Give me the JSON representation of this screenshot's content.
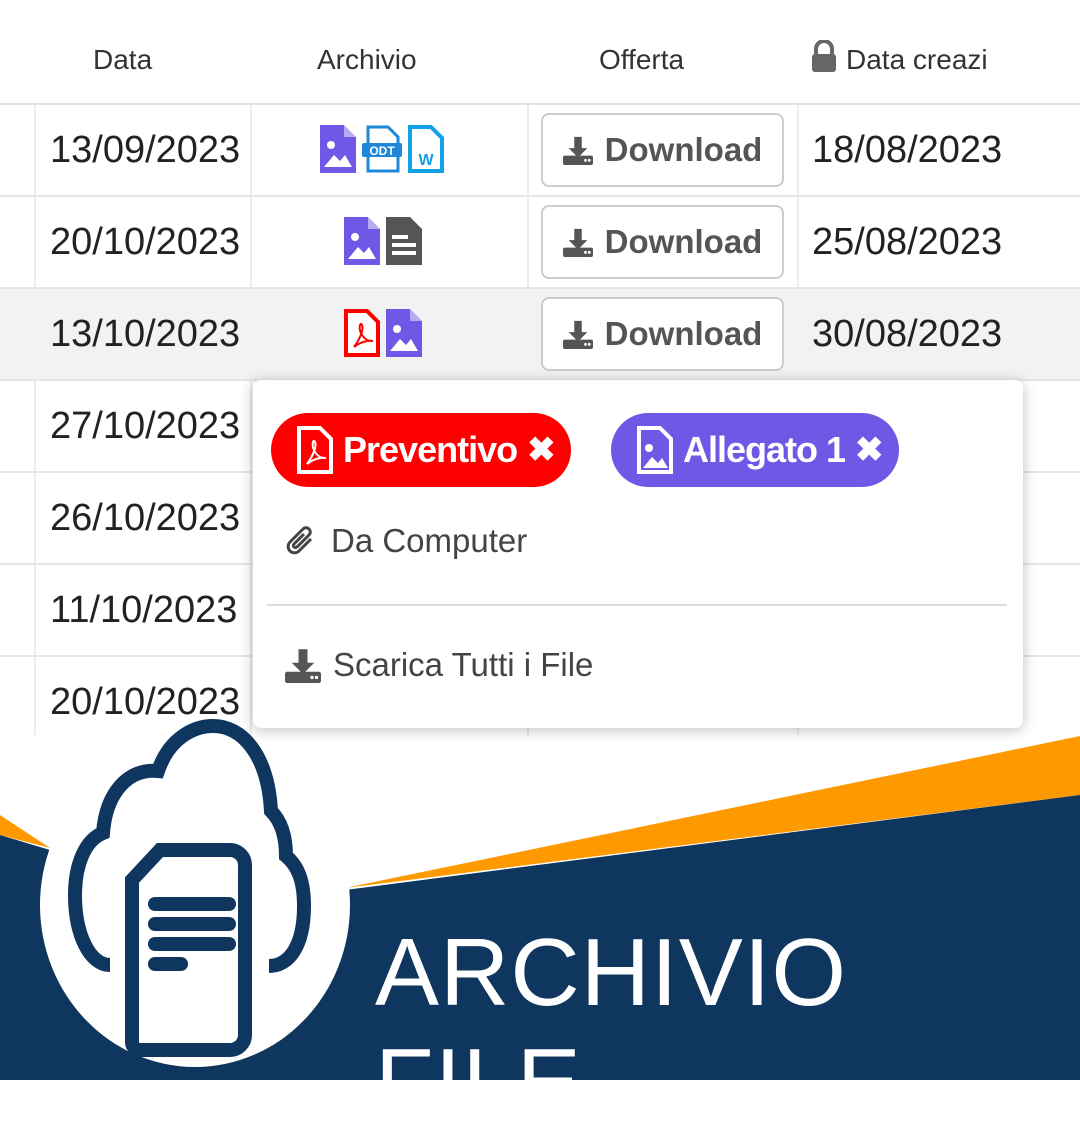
{
  "table": {
    "headers": {
      "data": "Data",
      "archivio": "Archivio",
      "offerta": "Offerta",
      "data_creazione": "Data creazi"
    },
    "download_label": "Download",
    "rows": [
      {
        "data": "13/09/2023",
        "files": [
          "image",
          "odt",
          "word"
        ],
        "data_creazione": "18/08/2023"
      },
      {
        "data": "20/10/2023",
        "files": [
          "image",
          "text"
        ],
        "data_creazione": "25/08/2023"
      },
      {
        "data": "13/10/2023",
        "files": [
          "pdf",
          "image"
        ],
        "data_creazione": "30/08/2023"
      },
      {
        "data": "27/10/2023"
      },
      {
        "data": "26/10/2023"
      },
      {
        "data": "11/10/2023"
      },
      {
        "data": "20/10/2023"
      }
    ]
  },
  "menu": {
    "chips": [
      {
        "label": "Preventivo",
        "icon": "pdf-icon",
        "color": "#ff0000"
      },
      {
        "label": "Allegato 1",
        "icon": "image-icon",
        "color": "#7157e6"
      }
    ],
    "from_computer": "Da Computer",
    "download_all": "Scarica Tutti i File"
  },
  "banner": {
    "title": "ARCHIVIO FILE",
    "colors": {
      "navy": "#0f365e",
      "orange": "#ff9900"
    }
  }
}
